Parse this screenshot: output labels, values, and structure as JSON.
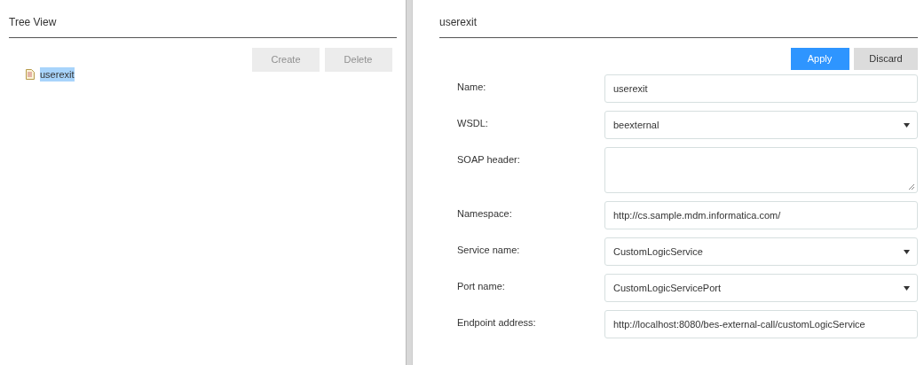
{
  "left_panel": {
    "title": "Tree View",
    "buttons": [
      {
        "label": "Create",
        "disabled": true
      },
      {
        "label": "Delete",
        "disabled": true
      }
    ],
    "tree": [
      {
        "label": "userexit",
        "selected": true
      }
    ]
  },
  "right_panel": {
    "title": "userexit",
    "buttons": [
      {
        "label": "Apply",
        "kind": "primary"
      },
      {
        "label": "Discard",
        "kind": "secondary"
      }
    ],
    "fields": [
      {
        "label": "Name:",
        "kind": "text",
        "value": "userexit"
      },
      {
        "label": "WSDL:",
        "kind": "select",
        "value": "beexternal"
      },
      {
        "label": "SOAP header:",
        "kind": "textarea"
      },
      {
        "label": "Namespace:",
        "kind": "text",
        "value": "http://cs.sample.mdm.informatica.com/"
      },
      {
        "label": "Service name:",
        "kind": "select",
        "value": "CustomLogicService"
      },
      {
        "label": "Port name:",
        "kind": "select",
        "value": "CustomLogicServicePort"
      },
      {
        "label": "Endpoint address:",
        "kind": "text",
        "value": "http://localhost:8080/bes-external-call/customLogicService"
      }
    ]
  }
}
